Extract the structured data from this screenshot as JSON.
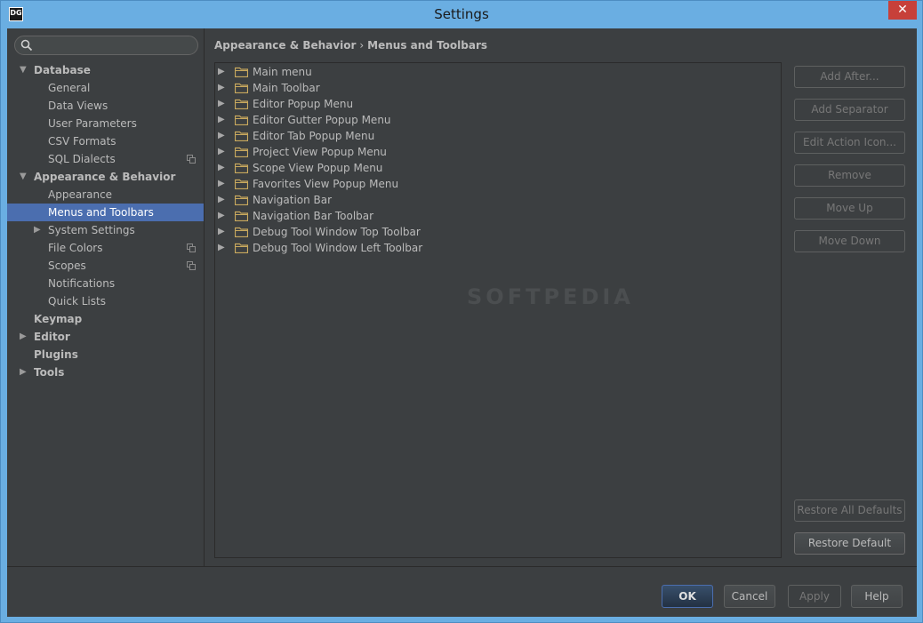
{
  "window": {
    "title": "Settings",
    "app_icon_text_top": "DG",
    "close_symbol": "✕"
  },
  "search": {
    "value": "",
    "placeholder": ""
  },
  "sidebar": {
    "items": [
      {
        "label": "Database",
        "level": 0,
        "bold": true,
        "arrow": "expanded",
        "selected": false,
        "copy_icon": false
      },
      {
        "label": "General",
        "level": 1,
        "bold": false,
        "arrow": "none",
        "selected": false,
        "copy_icon": false
      },
      {
        "label": "Data Views",
        "level": 1,
        "bold": false,
        "arrow": "none",
        "selected": false,
        "copy_icon": false
      },
      {
        "label": "User Parameters",
        "level": 1,
        "bold": false,
        "arrow": "none",
        "selected": false,
        "copy_icon": false
      },
      {
        "label": "CSV Formats",
        "level": 1,
        "bold": false,
        "arrow": "none",
        "selected": false,
        "copy_icon": false
      },
      {
        "label": "SQL Dialects",
        "level": 1,
        "bold": false,
        "arrow": "none",
        "selected": false,
        "copy_icon": true
      },
      {
        "label": "Appearance & Behavior",
        "level": 0,
        "bold": true,
        "arrow": "expanded",
        "selected": false,
        "copy_icon": false
      },
      {
        "label": "Appearance",
        "level": 1,
        "bold": false,
        "arrow": "none",
        "selected": false,
        "copy_icon": false
      },
      {
        "label": "Menus and Toolbars",
        "level": 1,
        "bold": false,
        "arrow": "none",
        "selected": true,
        "copy_icon": false
      },
      {
        "label": "System Settings",
        "level": 1,
        "bold": false,
        "arrow": "collapsed",
        "selected": false,
        "copy_icon": false
      },
      {
        "label": "File Colors",
        "level": 1,
        "bold": false,
        "arrow": "none",
        "selected": false,
        "copy_icon": true
      },
      {
        "label": "Scopes",
        "level": 1,
        "bold": false,
        "arrow": "none",
        "selected": false,
        "copy_icon": true
      },
      {
        "label": "Notifications",
        "level": 1,
        "bold": false,
        "arrow": "none",
        "selected": false,
        "copy_icon": false
      },
      {
        "label": "Quick Lists",
        "level": 1,
        "bold": false,
        "arrow": "none",
        "selected": false,
        "copy_icon": false
      },
      {
        "label": "Keymap",
        "level": 0,
        "bold": true,
        "arrow": "none",
        "selected": false,
        "copy_icon": false
      },
      {
        "label": "Editor",
        "level": 0,
        "bold": true,
        "arrow": "collapsed",
        "selected": false,
        "copy_icon": false
      },
      {
        "label": "Plugins",
        "level": 0,
        "bold": true,
        "arrow": "none",
        "selected": false,
        "copy_icon": false
      },
      {
        "label": "Tools",
        "level": 0,
        "bold": true,
        "arrow": "collapsed",
        "selected": false,
        "copy_icon": false
      }
    ]
  },
  "breadcrumb": {
    "parent": "Appearance & Behavior",
    "separator": "›",
    "current": "Menus and Toolbars"
  },
  "menus": [
    "Main menu",
    "Main Toolbar",
    "Editor Popup Menu",
    "Editor Gutter Popup Menu",
    "Editor Tab Popup Menu",
    "Project View Popup Menu",
    "Scope View Popup Menu",
    "Favorites View Popup Menu",
    "Navigation Bar",
    "Navigation Bar Toolbar",
    "Debug Tool Window Top Toolbar",
    "Debug Tool Window Left Toolbar"
  ],
  "actions": {
    "add_after": "Add After...",
    "add_separator": "Add Separator",
    "edit_action_icon": "Edit Action Icon...",
    "remove": "Remove",
    "move_up": "Move Up",
    "move_down": "Move Down",
    "restore_all_defaults": "Restore All Defaults",
    "restore_default": "Restore Default"
  },
  "footer": {
    "ok": "OK",
    "cancel": "Cancel",
    "apply": "Apply",
    "help": "Help"
  },
  "watermark": "SOFTPEDIA",
  "colors": {
    "background": "#3c3f41",
    "selection": "#4b6eaf",
    "title_bar": "#6aaee2",
    "folder": "#c9a95e",
    "close_button": "#c7403a"
  }
}
